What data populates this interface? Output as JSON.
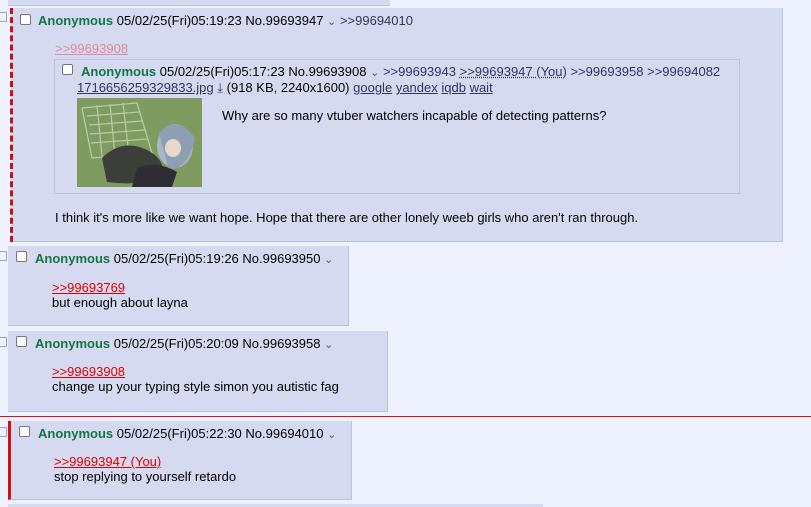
{
  "posts": [
    {
      "name": "Anonymous",
      "datetime": "05/02/25(Fri)05:19:23",
      "number": "No.99693947",
      "backlinks": ">>99694010",
      "quote_link": ">>99693908",
      "inline": {
        "name": "Anonymous",
        "datetime": "05/02/25(Fri)05:17:23",
        "number": "No.99693908",
        "backlink1": ">>99693943",
        "backlink2": ">>99693947 (You)",
        "backlink3": ">>99693958",
        "backlink4": ">>99694082",
        "file_name": "1716656259329833.jpg",
        "file_info": "(918 KB, 2240x1600)",
        "search_google": "google",
        "search_yandex": "yandex",
        "search_iqdb": "iqdb",
        "search_wait": "wait",
        "message": "Why are so many vtuber watchers incapable of detecting patterns?"
      },
      "message": "I think it's more like we want hope. Hope that there are other lonely weeb girls who aren't ran through."
    },
    {
      "name": "Anonymous",
      "datetime": "05/02/25(Fri)05:19:26",
      "number": "No.99693950",
      "quote_link": ">>99693769",
      "message": "but enough about layna"
    },
    {
      "name": "Anonymous",
      "datetime": "05/02/25(Fri)05:20:09",
      "number": "No.99693958",
      "quote_link": ">>99693908",
      "message": "change up your typing style simon you autistic fag"
    },
    {
      "name": "Anonymous",
      "datetime": "05/02/25(Fri)05:22:30",
      "number": "No.99694010",
      "quote_link": ">>99693947 (You)",
      "message": "stop replying to yourself retardo"
    }
  ],
  "icons": {
    "menu": "chevron-down-icon",
    "download": "download-icon"
  },
  "colors": {
    "name": "#117743",
    "quote": "#dd0000",
    "reply_bg": "#d6daf0",
    "page_bg": "#eef2ff",
    "highlight_border": "#cc1111"
  }
}
